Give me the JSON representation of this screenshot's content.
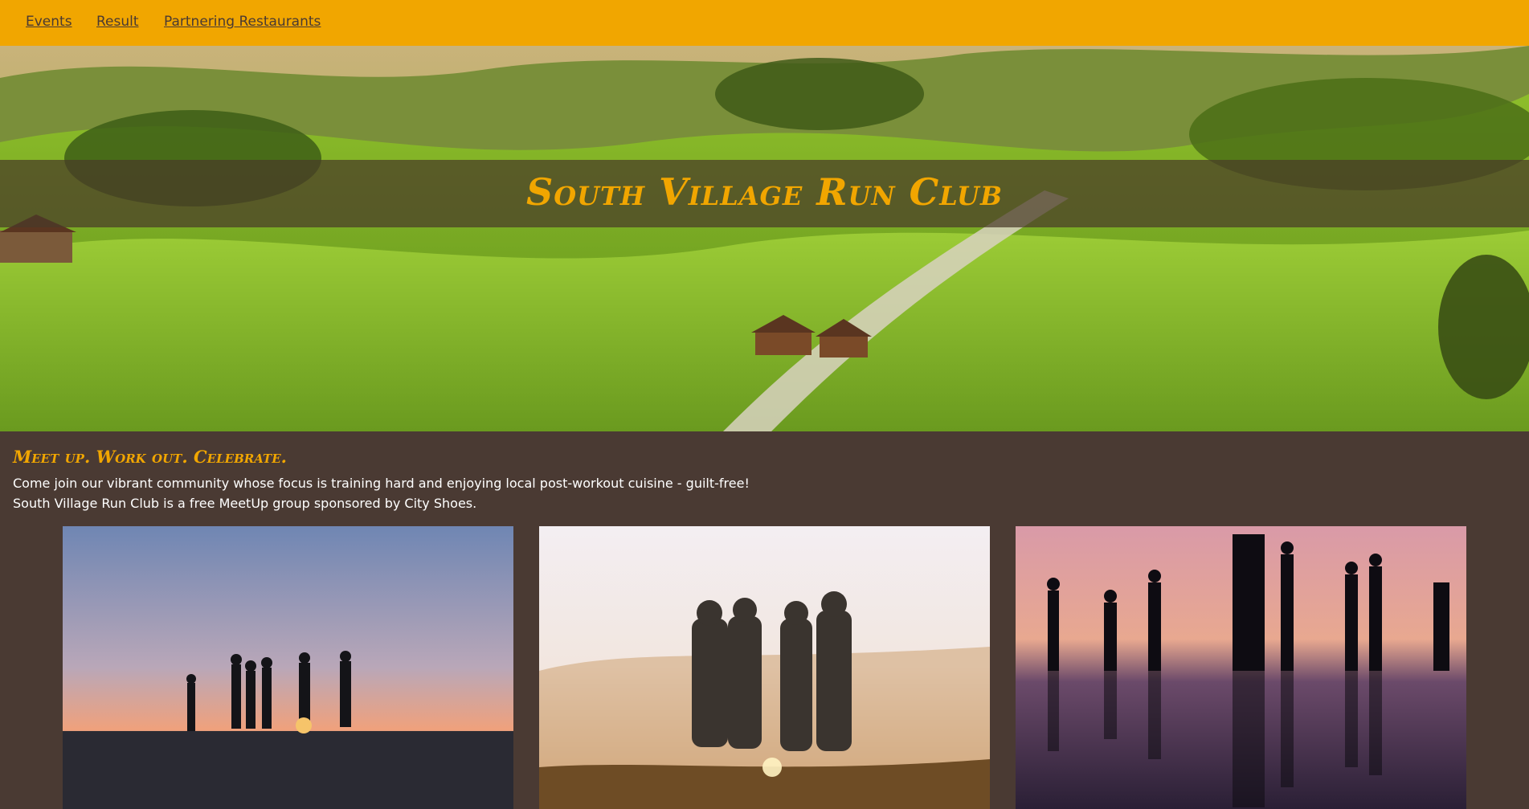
{
  "nav": {
    "links": [
      "Events",
      "Result",
      "Partnering Restaurants"
    ]
  },
  "hero": {
    "title": "South Village Run Club"
  },
  "intro": {
    "tagline": "Meet up. Work out. Celebrate.",
    "line1": "Come join our vibrant community whose focus is training hard and enjoying local post-workout cuisine - guilt-free!",
    "line2": "South Village Run Club is a free MeetUp group sponsored by City Shoes."
  },
  "colors": {
    "accent": "#f1a600",
    "background": "#4a3a33",
    "text": "#ffffff"
  }
}
